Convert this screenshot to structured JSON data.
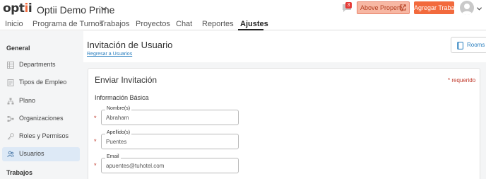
{
  "header": {
    "logo_text": "optii",
    "org_name": "Optii Demo Prime",
    "chat_badge": "3",
    "above_property_label": "Above Property",
    "add_job_label": "Agregar Trabajo",
    "accent_color": "#f26a3d"
  },
  "tabs": [
    {
      "label": "Inicio"
    },
    {
      "label": "Programa de Turnos"
    },
    {
      "label": "Trabajos"
    },
    {
      "label": "Proyectos"
    },
    {
      "label": "Chat"
    },
    {
      "label": "Reportes"
    },
    {
      "label": "Ajustes",
      "active": true
    }
  ],
  "sidebar": {
    "general_heading": "General",
    "items": [
      {
        "label": "Departments",
        "icon": "grid-icon"
      },
      {
        "label": "Tipos de Empleo",
        "icon": "document-icon"
      },
      {
        "label": "Plano",
        "icon": "hierarchy-icon"
      },
      {
        "label": "Organizaciones",
        "icon": "org-chart-icon"
      },
      {
        "label": "Roles y Permisos",
        "icon": "key-icon"
      },
      {
        "label": "Usuarios",
        "icon": "users-icon",
        "active": true
      }
    ],
    "jobs_heading": "Trabajos"
  },
  "main": {
    "page_title": "Invitación de Usuario",
    "back_link": "Regresar a Usuarios",
    "rooms_label": "Rooms"
  },
  "form": {
    "card_title": "Enviar Invitación",
    "required_note": "* requerido",
    "section_title": "Información Básica",
    "required_marker": "*",
    "fields": [
      {
        "label": "Nombre(s)",
        "value": "Abraham"
      },
      {
        "label": "Apellido(s)",
        "value": "Puentes"
      },
      {
        "label": "Email",
        "value": "apuentes@tuhotel.com"
      }
    ]
  }
}
